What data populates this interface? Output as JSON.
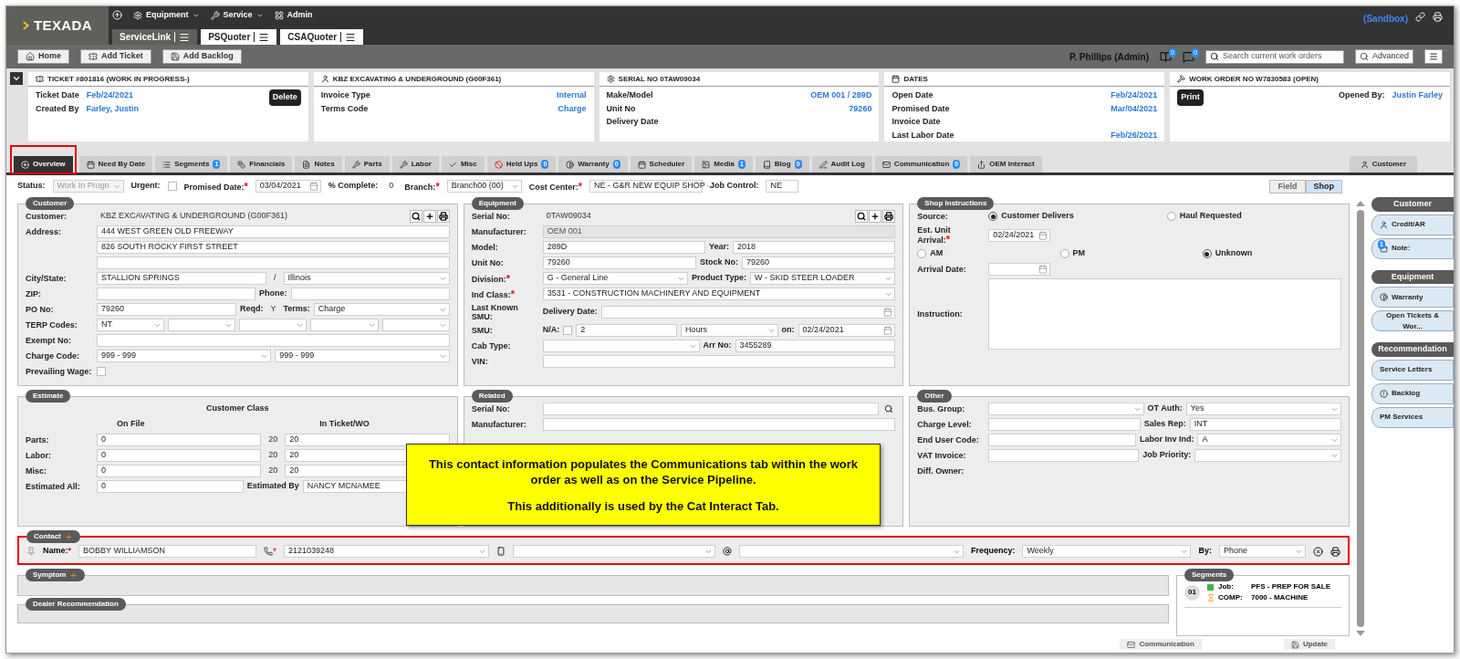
{
  "app": {
    "logo": "TEXADA",
    "menu": [
      "Equipment",
      "Service",
      "Admin"
    ],
    "app_tabs": [
      {
        "label": "ServiceLink",
        "selected": true
      },
      {
        "label": "PSQuoter",
        "selected": false
      },
      {
        "label": "CSAQuoter",
        "selected": false
      }
    ],
    "environment": "(Sandbox)"
  },
  "toolbar": {
    "buttons": [
      "Home",
      "Add Ticket",
      "Add Backlog"
    ],
    "user": "P. Phillips (Admin)",
    "badges": [
      "0",
      "0"
    ],
    "search": {
      "placeholder": "Search current work orders"
    },
    "advanced": "Advanced"
  },
  "cards": [
    {
      "kind": "ticket",
      "title": "TICKET #801816 (WORK IN PROGRESS-)",
      "button": "Delete",
      "fields": [
        {
          "label": "Ticket Date",
          "value": "Feb/24/2021"
        },
        {
          "label": "Created By",
          "value": "Farley, Justin"
        }
      ]
    },
    {
      "kind": "info",
      "title": "KBZ EXCAVATING & UNDERGROUND (G00F361)",
      "fields": [
        {
          "label": "Invoice Type",
          "value": "Internal"
        },
        {
          "label": "Terms Code",
          "value": "Charge"
        }
      ]
    },
    {
      "kind": "info",
      "title": "SERIAL NO 0TAW09034",
      "fields": [
        {
          "label": "Make/Model",
          "value": "OEM 001 / 289D"
        },
        {
          "label": "Unit No",
          "value": "79260"
        },
        {
          "label": "Delivery Date"
        }
      ]
    },
    {
      "kind": "info",
      "title": "DATES",
      "fields": [
        {
          "label": "Open Date",
          "value": "Feb/24/2021"
        },
        {
          "label": "Promised Date",
          "value": "Mar/04/2021"
        },
        {
          "label": "Invoice Date"
        },
        {
          "label": "Last Labor Date",
          "value": "Feb/26/2021"
        }
      ]
    },
    {
      "kind": "work_order",
      "title": "WORK ORDER NO W7830583 (OPEN)",
      "button": "Print",
      "fields": [
        {
          "label": "Opened By:",
          "value": "Justin Farley"
        }
      ]
    }
  ],
  "tabs": [
    {
      "label": "Overview",
      "selected": true
    },
    {
      "label": "Need By Date",
      "selected": false
    },
    {
      "label": "Segments",
      "badge": "1",
      "selected": false
    },
    {
      "label": "Financials",
      "selected": false
    },
    {
      "label": "Notes",
      "selected": false
    },
    {
      "label": "Parts",
      "selected": false
    },
    {
      "label": "Labor",
      "selected": false
    },
    {
      "label": "Misc",
      "selected": false
    },
    {
      "label": "Held Ups",
      "badge": "0",
      "selected": false
    },
    {
      "label": "Warranty",
      "badge": "0",
      "selected": false
    },
    {
      "label": "Scheduler",
      "selected": false
    },
    {
      "label": "Media",
      "badge": "1",
      "selected": false
    },
    {
      "label": "Blog",
      "badge": "0",
      "selected": false
    },
    {
      "label": "Audit Log",
      "selected": false
    },
    {
      "label": "Communication",
      "badge": "0",
      "selected": false
    },
    {
      "label": "OEM Interact",
      "selected": false
    }
  ],
  "side_tab": "Customer",
  "filters": [
    {
      "kind": "label",
      "text": "Status:"
    },
    {
      "kind": "select",
      "value": "Work In Progn",
      "disabled": true
    },
    {
      "kind": "label",
      "text": "Urgent:"
    },
    {
      "kind": "checkbox",
      "checked": false
    },
    {
      "kind": "label",
      "text": "Promised Date:",
      "mark": "*"
    },
    {
      "kind": "date",
      "value": "03/04/2021"
    },
    {
      "kind": "label",
      "text": "% Complete:"
    },
    {
      "kind": "text",
      "text": "0"
    },
    {
      "kind": "label",
      "text": "Branch:",
      "mark": "*"
    },
    {
      "kind": "select",
      "value": "Branch00 (00)"
    },
    {
      "kind": "label",
      "text": "Cost Center:",
      "mark": "*"
    },
    {
      "kind": "select",
      "value": "NE - G&R NEW EQUIP SHOP"
    },
    {
      "kind": "label",
      "text": "Job Control:"
    },
    {
      "kind": "input",
      "value": "NE"
    }
  ],
  "view_toggle": [
    {
      "label": "Field",
      "selected": false
    },
    {
      "label": "Shop",
      "selected": true
    }
  ],
  "panels": [
    {
      "title": "Customer",
      "rows": [
        {
          "label": "Customer:",
          "fields": [
            {
              "kind": "text",
              "text": "KBZ EXCAVATING & UNDERGROUND (G00F361)"
            },
            {
              "kind": "tools"
            }
          ]
        },
        {
          "label": "Address:",
          "fields": [
            {
              "kind": "input",
              "value": "444 WEST GREEN OLD FREEWAY"
            }
          ]
        },
        {
          "fields": [
            {
              "kind": "input",
              "value": "826 SOUTH ROCKY FIRST STREET"
            }
          ]
        },
        {
          "fields": [
            {
              "kind": "input"
            }
          ]
        },
        {
          "label": "City/State:",
          "fields": [
            {
              "kind": "input",
              "value": "STALLION SPRINGS"
            },
            {
              "kind": "text",
              "text": "/"
            },
            {
              "kind": "select",
              "value": "Illinois"
            }
          ]
        },
        {
          "label": "ZIP:",
          "fields": [
            {
              "kind": "input"
            },
            {
              "kind": "label",
              "text": "Phone:"
            },
            {
              "kind": "input"
            }
          ]
        },
        {
          "label": "PO No:",
          "fields": [
            {
              "kind": "input",
              "value": "79260"
            },
            {
              "kind": "label",
              "text": "Reqd:"
            },
            {
              "kind": "text",
              "text": "Y"
            },
            {
              "kind": "label",
              "text": "Terms:"
            },
            {
              "kind": "select",
              "value": "Charge"
            }
          ]
        },
        {
          "label": "TERP Codes:",
          "fields": [
            {
              "kind": "select",
              "value": "NT"
            },
            {
              "kind": "select"
            },
            {
              "kind": "select"
            },
            {
              "kind": "select"
            },
            {
              "kind": "select"
            }
          ]
        },
        {
          "label": "Exempt No:",
          "fields": [
            {
              "kind": "input"
            }
          ]
        },
        {
          "label": "Charge Code:",
          "fields": [
            {
              "kind": "select",
              "value": "999 - 999"
            },
            {
              "kind": "select",
              "value": "999 - 999"
            }
          ]
        },
        {
          "label": "Prevailing Wage:",
          "fields": [
            {
              "kind": "checkbox",
              "checked": false
            }
          ]
        }
      ]
    },
    {
      "title": "Equipment",
      "rows": [
        {
          "label": "Serial No:",
          "fields": [
            {
              "kind": "text",
              "text": "0TAW09034"
            },
            {
              "kind": "tools"
            }
          ]
        },
        {
          "label": "Manufacturer:",
          "fields": [
            {
              "kind": "input",
              "value": "OEM 001",
              "disabled": true
            }
          ]
        },
        {
          "label": "Model:",
          "fields": [
            {
              "kind": "input",
              "value": "289D"
            },
            {
              "kind": "label",
              "text": "Year:"
            },
            {
              "kind": "input",
              "value": "2018"
            }
          ]
        },
        {
          "label": "Unit No:",
          "fields": [
            {
              "kind": "input",
              "value": "79260"
            },
            {
              "kind": "label",
              "text": "Stock No:"
            },
            {
              "kind": "input",
              "value": "79260"
            }
          ]
        },
        {
          "label": "Division:",
          "mark": "*",
          "fields": [
            {
              "kind": "select",
              "value": "G - General Line"
            },
            {
              "kind": "label",
              "text": "Product Type:"
            },
            {
              "kind": "select",
              "value": "W - SKID STEER LOADER"
            }
          ]
        },
        {
          "label": "Ind Class:",
          "mark": "*",
          "fields": [
            {
              "kind": "select",
              "value": "3531 - CONSTRUCTION MACHINERY AND EQUIPMENT"
            }
          ]
        },
        {
          "label": "Last Known SMU:",
          "fields": [
            {
              "kind": "label",
              "text": "Delivery Date:"
            },
            {
              "kind": "date"
            }
          ]
        },
        {
          "label": "SMU:",
          "fields": [
            {
              "kind": "label",
              "text": "N/A:"
            },
            {
              "kind": "checkbox",
              "checked": false
            },
            {
              "kind": "input",
              "value": "2"
            },
            {
              "kind": "select",
              "value": "Hours"
            },
            {
              "kind": "label",
              "text": "on:"
            },
            {
              "kind": "date",
              "value": "02/24/2021"
            }
          ]
        },
        {
          "label": "Cab Type:",
          "fields": [
            {
              "kind": "select"
            },
            {
              "kind": "label",
              "text": "Arr No:"
            },
            {
              "kind": "input",
              "value": "3455289"
            }
          ]
        },
        {
          "label": "VIN:",
          "fields": [
            {
              "kind": "input"
            }
          ]
        }
      ]
    },
    {
      "title": "Shop Instructions",
      "rows": [
        {
          "label": "Source:",
          "fields": [
            {
              "kind": "radio",
              "label": "Customer Delivers",
              "selected": true
            },
            {
              "kind": "radio",
              "label": "Haul Requested",
              "selected": false
            }
          ]
        },
        {
          "label": "Est. Unit Arrival:",
          "mark": "*",
          "fields": [
            {
              "kind": "date",
              "value": "02/24/2021"
            }
          ]
        },
        {
          "fields": [
            {
              "kind": "radio",
              "label": "AM",
              "selected": false
            },
            {
              "kind": "radio",
              "label": "PM",
              "selected": false
            },
            {
              "kind": "radio",
              "label": "Unknown",
              "selected": true
            }
          ]
        },
        {
          "label": "Arrival Date:",
          "fields": [
            {
              "kind": "date"
            }
          ]
        },
        {
          "label": "Instruction:",
          "fields": [
            {
              "kind": "textarea"
            }
          ]
        }
      ]
    },
    {
      "title": "Estimate",
      "rows": [
        {
          "fields": [
            {
              "kind": "heading",
              "text": "Customer Class"
            }
          ]
        },
        {
          "fields": [
            {
              "kind": "heading",
              "text": "On File"
            },
            {
              "kind": "heading",
              "text": "In Ticket/WO"
            }
          ]
        },
        {
          "label": "Parts:",
          "fields": [
            {
              "kind": "input",
              "value": "0"
            },
            {
              "kind": "text",
              "text": "20"
            },
            {
              "kind": "input",
              "value": "20"
            }
          ]
        },
        {
          "label": "Labor:",
          "fields": [
            {
              "kind": "input",
              "value": "0"
            },
            {
              "kind": "text",
              "text": "20"
            },
            {
              "kind": "input",
              "value": "20"
            }
          ]
        },
        {
          "label": "Misc:",
          "fields": [
            {
              "kind": "input",
              "value": "0"
            },
            {
              "kind": "text",
              "text": "20"
            },
            {
              "kind": "input",
              "value": "20"
            }
          ]
        },
        {
          "label": "Estimated All:",
          "fields": [
            {
              "kind": "input",
              "value": "0"
            },
            {
              "kind": "label",
              "text": "Estimated By"
            },
            {
              "kind": "input",
              "value": "NANCY MCNAMEE"
            }
          ]
        }
      ]
    },
    {
      "title": "Related",
      "rows": [
        {
          "label": "Serial No:",
          "fields": [
            {
              "kind": "input"
            },
            {
              "kind": "search"
            }
          ]
        },
        {
          "label": "Manufacturer:",
          "fields": [
            {
              "kind": "input"
            }
          ]
        }
      ]
    },
    {
      "title": "Other",
      "rows": [
        {
          "label": "Bus. Group:",
          "fields": [
            {
              "kind": "select"
            },
            {
              "kind": "label",
              "text": "OT Auth:"
            },
            {
              "kind": "select",
              "value": "Yes"
            }
          ]
        },
        {
          "label": "Charge Level:",
          "fields": [
            {
              "kind": "input"
            },
            {
              "kind": "label",
              "text": "Sales Rep:"
            },
            {
              "kind": "input",
              "value": "INT"
            }
          ]
        },
        {
          "label": "End User Code:",
          "fields": [
            {
              "kind": "input"
            },
            {
              "kind": "label",
              "text": "Labor Inv Ind:"
            },
            {
              "kind": "select",
              "value": "A"
            }
          ]
        },
        {
          "label": "VAT Invoice:",
          "fields": [
            {
              "kind": "input"
            },
            {
              "kind": "label",
              "text": "Job Priority:"
            },
            {
              "kind": "select"
            }
          ]
        },
        {
          "label": "Diff. Owner:",
          "fields": []
        }
      ]
    }
  ],
  "callout": [
    "This contact information populates the Communications tab within the work order as well as on the Service Pipeline.",
    "This additionally is used by the Cat Interact Tab."
  ],
  "contact": {
    "title": "Contact",
    "name_label": "Name:",
    "mark": "*",
    "name": "BOBBY WILLIAMSON",
    "phone_mark": "*",
    "phone": "2121039248",
    "frequency_label": "Frequency:",
    "frequency": "Weekly",
    "by_label": "By:",
    "by": "Phone"
  },
  "symptom": {
    "title": "Symptom"
  },
  "dealer_recommendation": {
    "title": "Dealer Recommendation"
  },
  "segments": {
    "title": "Segments",
    "items": [
      {
        "number": "01",
        "job_label": "Job:",
        "job": "PFS - PREP FOR SALE",
        "comp_label": "COMP:",
        "comp": "7000 - MACHINE"
      }
    ]
  },
  "sidebar": [
    {
      "title": "Customer",
      "items": [
        {
          "label": "Credit/AR"
        },
        {
          "label": "Note:",
          "badge": "1"
        }
      ]
    },
    {
      "title": "Equipment",
      "items": [
        {
          "label": "Warranty"
        },
        {
          "label": "Open Tickets & Wor..."
        }
      ]
    },
    {
      "title": "Recommendation",
      "items": [
        {
          "label": "Service Letters"
        },
        {
          "label": "Backlog"
        },
        {
          "label": "PM Services"
        }
      ]
    }
  ],
  "footer": [
    "Communication",
    "Update"
  ]
}
